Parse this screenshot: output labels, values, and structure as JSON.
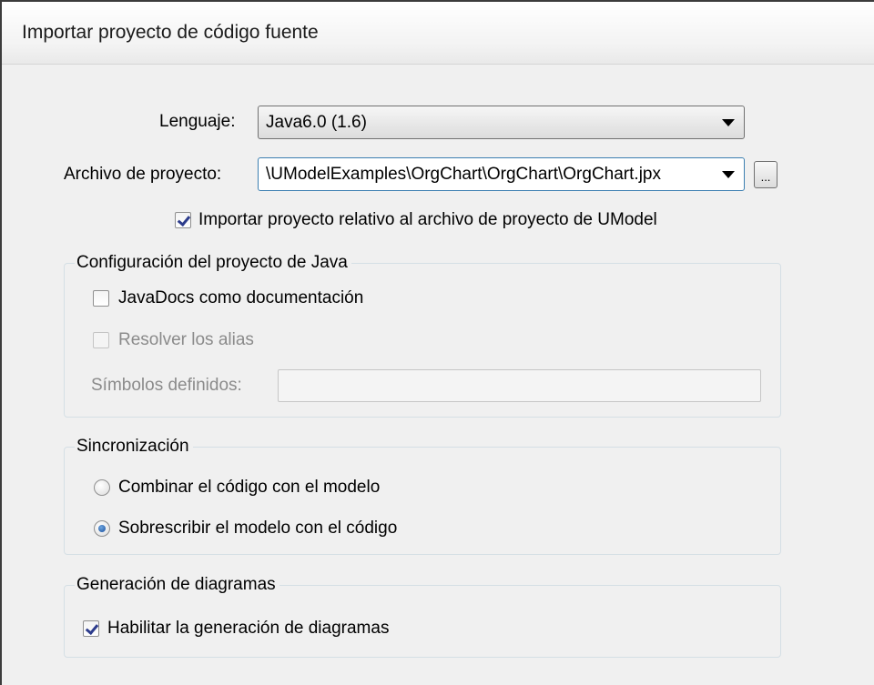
{
  "dialog": {
    "title": "Importar proyecto de código fuente"
  },
  "language": {
    "label": "Lenguaje:",
    "value": "Java6.0 (1.6)"
  },
  "project_file": {
    "label": "Archivo de proyecto:",
    "value": "\\UModelExamples\\OrgChart\\OrgChart\\OrgChart.jpx",
    "browse_label": "..."
  },
  "import_relative": {
    "label": "Importar proyecto relativo al archivo de proyecto de UModel",
    "checked": true
  },
  "java_settings": {
    "legend": "Configuración del proyecto de Java",
    "javadocs_label": "JavaDocs como documentación",
    "javadocs_checked": false,
    "resolve_alias_label": "Resolver los alias",
    "resolve_alias_checked": false,
    "symbols_label": "Símbolos definidos:",
    "symbols_value": ""
  },
  "sync": {
    "legend": "Sincronización",
    "option_merge": "Combinar el código con el modelo",
    "option_overwrite": "Sobrescribir el modelo con el código",
    "selected": "overwrite"
  },
  "diagrams": {
    "legend": "Generación de diagramas",
    "enable_label": "Habilitar la generación de diagramas",
    "enable_checked": true
  }
}
